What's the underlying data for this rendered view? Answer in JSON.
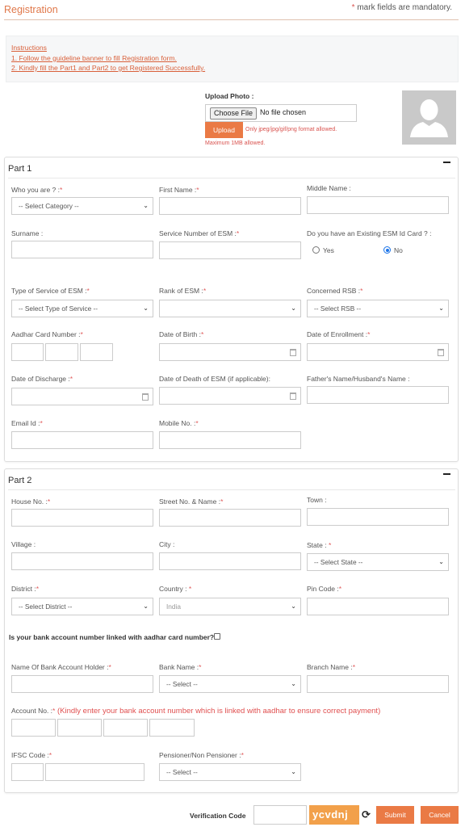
{
  "header": {
    "title": "Registration",
    "mandatory_star": "*",
    "mandatory_note": " mark fields are mandatory."
  },
  "instructions": {
    "heading": "Instructions",
    "items": [
      "1. Follow the guideline banner to fill Registration form.",
      "2. Kindly fill the Part1 and Part2 to get Registered Successfully."
    ]
  },
  "upload": {
    "label": "Upload Photo :",
    "choose_file": "Choose File",
    "no_file": "No file chosen",
    "upload_button": "Upload",
    "format_note": "Only jpeg/jpg/gif/png format allowed.",
    "size_note": "Maximum 1MB allowed."
  },
  "part1": {
    "title": "Part 1",
    "fields": {
      "who_you_are": {
        "label": "Who you are ? :",
        "value": "-- Select Category --"
      },
      "first_name": {
        "label": "First Name :"
      },
      "middle_name": {
        "label": "Middle Name :"
      },
      "surname": {
        "label": "Surname :"
      },
      "service_number": {
        "label": "Service Number of ESM :"
      },
      "existing_id": {
        "label": "Do you have an Existing ESM Id Card ? :",
        "yes": "Yes",
        "no": "No",
        "selected": "No"
      },
      "type_of_service": {
        "label": "Type of Service of ESM :",
        "value": "-- Select Type of Service --"
      },
      "rank": {
        "label": "Rank of ESM :",
        "value": ""
      },
      "rsb": {
        "label": "Concerned RSB :",
        "value": "-- Select RSB --"
      },
      "aadhar": {
        "label": "Aadhar Card Number :"
      },
      "dob": {
        "label": "Date of Birth :"
      },
      "doe": {
        "label": "Date of Enrollment :"
      },
      "discharge": {
        "label": "Date of Discharge :"
      },
      "death": {
        "label": "Date of Death of ESM (if applicable):"
      },
      "father": {
        "label": "Father's Name/Husband's Name :"
      },
      "email": {
        "label": "Email Id :"
      },
      "mobile": {
        "label": "Mobile No. :"
      }
    }
  },
  "part2": {
    "title": "Part 2",
    "fields": {
      "house": {
        "label": "House No. :"
      },
      "street": {
        "label": "Street No. & Name :"
      },
      "town": {
        "label": "Town :"
      },
      "village": {
        "label": "Village :"
      },
      "city": {
        "label": "City :"
      },
      "state": {
        "label": "State : ",
        "value": "-- Select State --"
      },
      "district": {
        "label": "District :",
        "value": "-- Select District --"
      },
      "country": {
        "label": "Country : ",
        "value": "India"
      },
      "pin": {
        "label": "Pin Code :"
      },
      "bank_linked": {
        "label": "Is your bank account number linked with aadhar card number?",
        "checked": false
      },
      "holder": {
        "label": "Name Of Bank Account Holder :"
      },
      "bank_name": {
        "label": "Bank Name :",
        "value": "-- Select --"
      },
      "branch": {
        "label": "Branch Name :"
      },
      "account": {
        "label": "Account No. :",
        "note": " (Kindly enter your bank account number which is linked with aadhar to ensure correct payment)"
      },
      "ifsc": {
        "label": "IFSC Code :"
      },
      "pensioner": {
        "label": "Pensioner/Non Pensioner :",
        "value": "-- Select --"
      }
    }
  },
  "footer": {
    "verification_label": "Verification Code",
    "captcha": "ycvdnj",
    "refresh_icon": "refresh-icon",
    "submit": "Submit",
    "cancel": "Cancel"
  },
  "star": "*",
  "chevron": "⌄",
  "colors": {
    "accent": "#ea7a45",
    "captcha": "#f2a04a",
    "required": "#e05a5a",
    "link": "#d9603a"
  }
}
